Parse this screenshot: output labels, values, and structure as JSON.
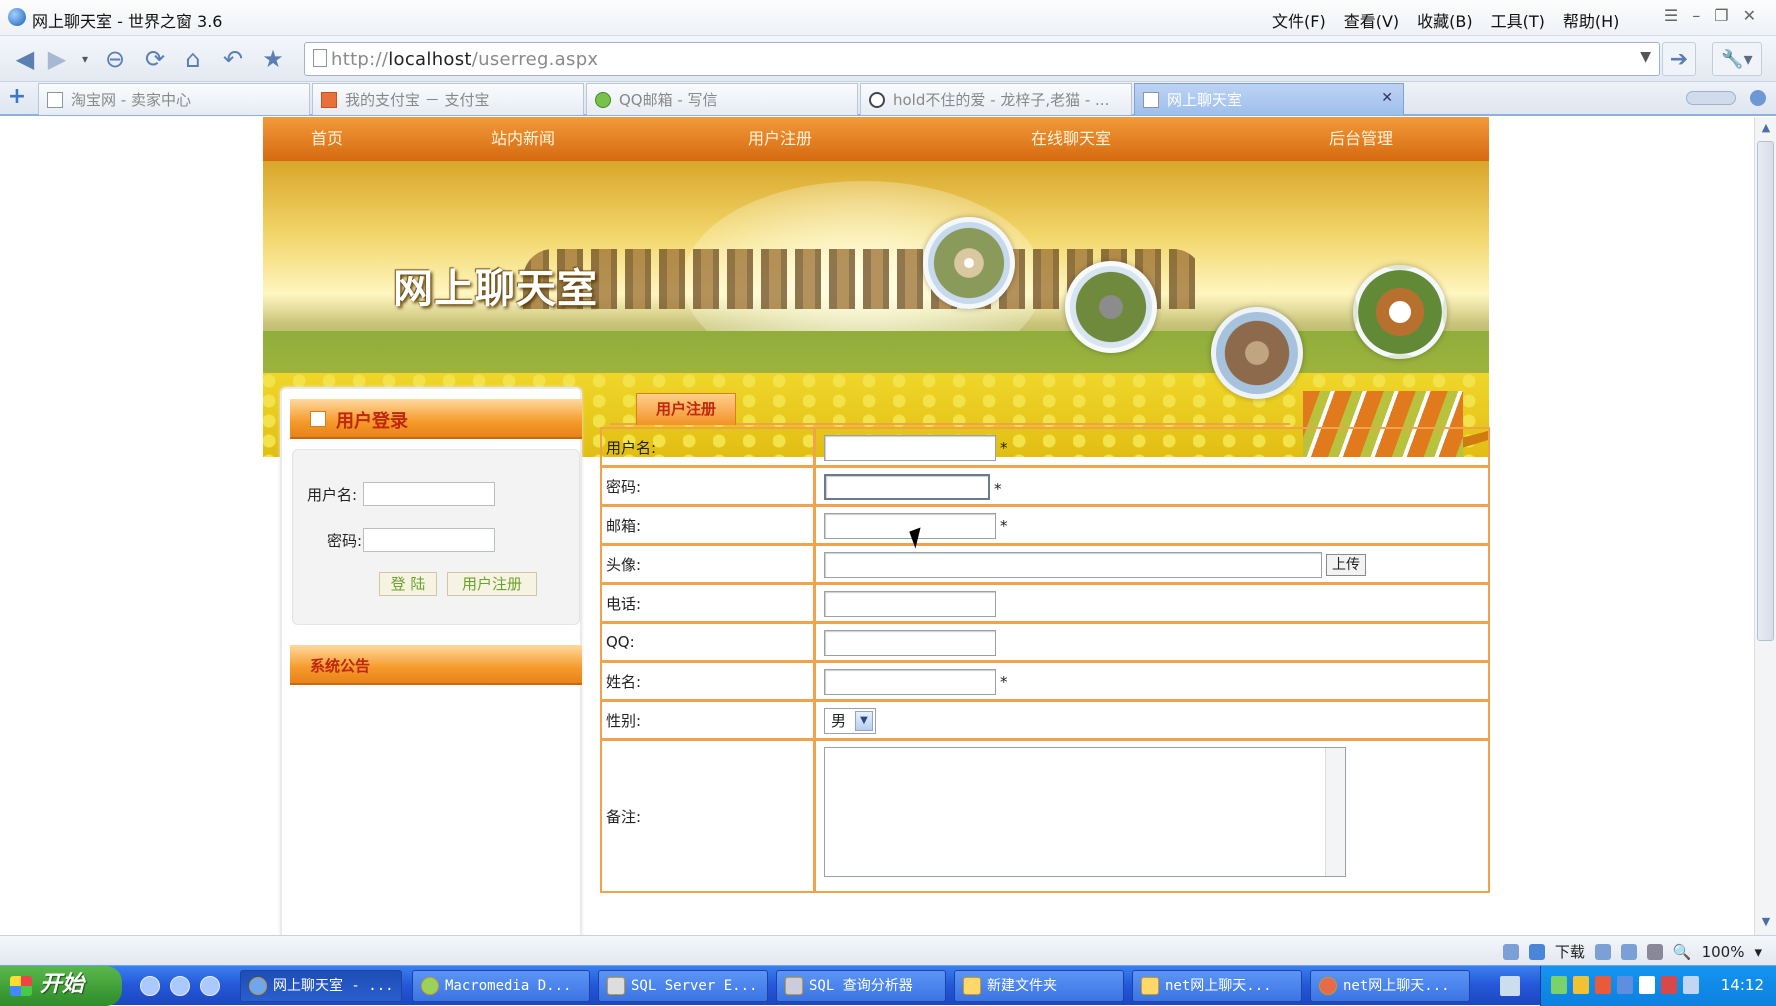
{
  "window": {
    "title": "网上聊天室 - 世界之窗 3.6"
  },
  "menu": [
    "文件(F)",
    "查看(V)",
    "收藏(B)",
    "工具(T)",
    "帮助(H)"
  ],
  "address": {
    "prefix": "http://",
    "host": "localhost",
    "path": "/userreg.aspx"
  },
  "tabs": [
    {
      "label": "淘宝网 - 卖家中心"
    },
    {
      "label": "我的支付宝 － 支付宝"
    },
    {
      "label": "QQ邮箱 - 写信"
    },
    {
      "label": "hold不住的爱 - 龙梓子,老猫 - ..."
    },
    {
      "label": "网上聊天室",
      "active": true
    }
  ],
  "site": {
    "nav": [
      "首页",
      "站内新闻",
      "用户注册",
      "在线聊天室",
      "后台管理"
    ],
    "banner_title": "网上聊天室"
  },
  "login": {
    "title": "用户登录",
    "username_label": "用户名:",
    "password_label": "密码:",
    "login_button": "登 陆",
    "register_button": "用户注册"
  },
  "announcement": {
    "title": "系统公告"
  },
  "register": {
    "tab": "用户注册",
    "fields": [
      {
        "label": "用户名:",
        "required": "*"
      },
      {
        "label": "密码:",
        "required": "*"
      },
      {
        "label": "邮箱:",
        "required": "*"
      },
      {
        "label": "头像:",
        "button": "上传"
      },
      {
        "label": "电话:"
      },
      {
        "label": "QQ:"
      },
      {
        "label": "姓名:",
        "required": "*"
      },
      {
        "label": "性别:",
        "value": "男"
      },
      {
        "label": "备注:"
      }
    ]
  },
  "statusbar": {
    "download": "下载",
    "zoom": "100%"
  },
  "taskbar": {
    "start": "开始",
    "buttons": [
      "网上聊天室 - ...",
      "Macromedia D...",
      "SQL Server E...",
      "SQL 查询分析器",
      "新建文件夹",
      "net网上聊天...",
      "net网上聊天..."
    ],
    "clock": "14:12"
  }
}
